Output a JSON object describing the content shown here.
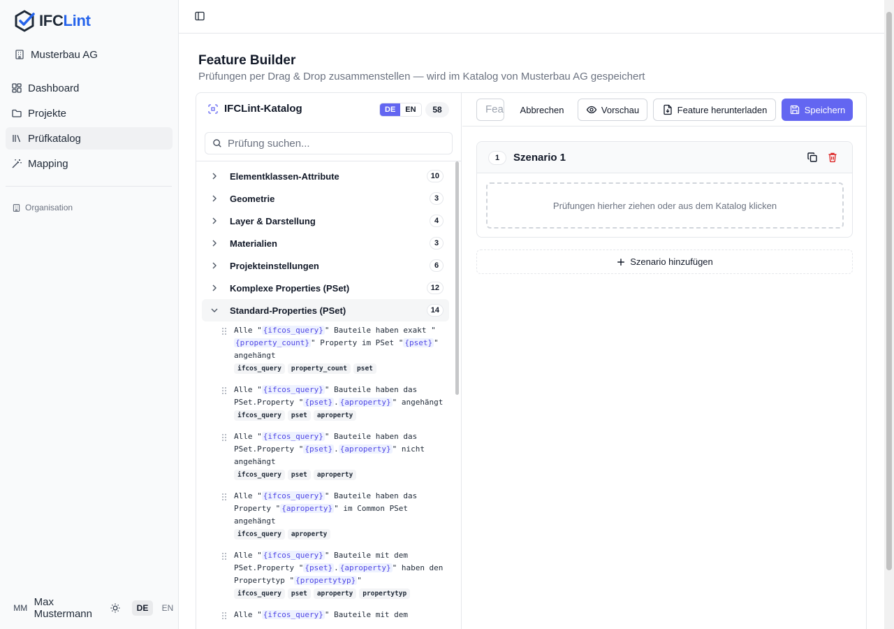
{
  "brand": {
    "name_part1": "IFC",
    "name_part2": "Lint"
  },
  "sidebar": {
    "organization": "Musterbau AG",
    "nav": [
      {
        "label": "Dashboard",
        "icon": "dashboard-icon"
      },
      {
        "label": "Projekte",
        "icon": "folder-icon"
      },
      {
        "label": "Prüfkatalog",
        "icon": "library-icon",
        "active": true
      },
      {
        "label": "Mapping",
        "icon": "wand-icon"
      }
    ],
    "section_label": "Organisation",
    "user": {
      "initials": "MM",
      "name": "Max Mustermann"
    },
    "languages": [
      "DE",
      "EN"
    ],
    "active_language": "DE"
  },
  "page": {
    "title": "Feature Builder",
    "subtitle": "Prüfungen per Drag & Drop zusammenstellen — wird im Katalog von Musterbau AG gespeichert"
  },
  "catalog": {
    "title": "IFCLint-Katalog",
    "lang_de": "DE",
    "lang_en": "EN",
    "count": "58",
    "search_placeholder": "Prüfung suchen...",
    "categories": [
      {
        "label": "Elementklassen-Attribute",
        "count": "10"
      },
      {
        "label": "Geometrie",
        "count": "3"
      },
      {
        "label": "Layer & Darstellung",
        "count": "4"
      },
      {
        "label": "Materialien",
        "count": "3"
      },
      {
        "label": "Projekteinstellungen",
        "count": "6"
      },
      {
        "label": "Komplexe Properties (PSet)",
        "count": "12"
      },
      {
        "label": "Standard-Properties (PSet)",
        "count": "14"
      }
    ],
    "rules": [
      {
        "parts": [
          "Alle \"",
          "{ifcos_query}",
          "\" Bauteile haben exakt \"",
          "{property_count}",
          "\" Property im PSet \"",
          "{pset}",
          "\" angehängt"
        ],
        "tags": [
          "ifcos_query",
          "property_count",
          "pset"
        ]
      },
      {
        "parts": [
          "Alle \"",
          "{ifcos_query}",
          "\" Bauteile haben das PSet.Property \"",
          "{pset}",
          ".",
          "{aproperty}",
          "\" angehängt"
        ],
        "tags": [
          "ifcos_query",
          "pset",
          "aproperty"
        ]
      },
      {
        "parts": [
          "Alle \"",
          "{ifcos_query}",
          "\" Bauteile haben das PSet.Property \"",
          "{pset}",
          ".",
          "{aproperty}",
          "\" nicht angehängt"
        ],
        "tags": [
          "ifcos_query",
          "pset",
          "aproperty"
        ]
      },
      {
        "parts": [
          "Alle \"",
          "{ifcos_query}",
          "\" Bauteile haben das Property \"",
          "{aproperty}",
          "\" im Common PSet angehängt"
        ],
        "tags": [
          "ifcos_query",
          "aproperty"
        ]
      },
      {
        "parts": [
          "Alle \"",
          "{ifcos_query}",
          "\" Bauteile mit dem PSet.Property \"",
          "{pset}",
          ".",
          "{aproperty}",
          "\" haben den Propertytyp \"",
          "{propertytyp}",
          "\""
        ],
        "tags": [
          "ifcos_query",
          "pset",
          "aproperty",
          "propertytyp"
        ]
      },
      {
        "parts": [
          "Alle \"",
          "{ifcos_query}",
          "\" Bauteile mit dem"
        ],
        "tags": []
      }
    ]
  },
  "builder": {
    "name_value": "Feature",
    "cancel_label": "Abbrechen",
    "preview_label": "Vorschau",
    "download_label": "Feature herunterladen",
    "save_label": "Speichern",
    "scenario": {
      "number": "1",
      "title": "Szenario 1",
      "dropzone_text": "Prüfungen hierher ziehen oder aus dem Katalog klicken"
    },
    "add_scenario_label": "Szenario hinzufügen"
  },
  "colors": {
    "accent": "#6366f1",
    "brand_blue": "#2563eb",
    "danger": "#dc2626"
  }
}
